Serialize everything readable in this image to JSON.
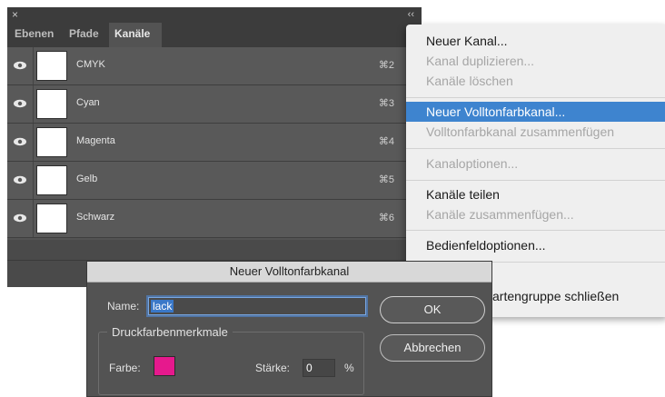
{
  "panel": {
    "close_glyph": "×",
    "collapse_glyph": "‹‹",
    "tabs": [
      {
        "label": "Ebenen"
      },
      {
        "label": "Pfade"
      },
      {
        "label": "Kanäle"
      }
    ],
    "channels": [
      {
        "name": "CMYK",
        "shortcut": "⌘2"
      },
      {
        "name": "Cyan",
        "shortcut": "⌘3"
      },
      {
        "name": "Magenta",
        "shortcut": "⌘4"
      },
      {
        "name": "Gelb",
        "shortcut": "⌘5"
      },
      {
        "name": "Schwarz",
        "shortcut": "⌘6"
      }
    ]
  },
  "menu": {
    "items": [
      {
        "label": "Neuer Kanal...",
        "enabled": true
      },
      {
        "label": "Kanal duplizieren...",
        "enabled": false
      },
      {
        "label": "Kanäle löschen",
        "enabled": false
      },
      {
        "label": "Neuer Volltonfarbkanal...",
        "enabled": true,
        "selected": true
      },
      {
        "label": "Volltonfarbkanal zusammenfügen",
        "enabled": false
      },
      {
        "label": "Kanaloptionen...",
        "enabled": false
      },
      {
        "label": "Kanäle teilen",
        "enabled": true
      },
      {
        "label": "Kanäle zusammenfügen...",
        "enabled": false
      },
      {
        "label": "Bedienfeldoptionen...",
        "enabled": true
      },
      {
        "label": "artengruppe schließen",
        "enabled": true
      }
    ]
  },
  "dialog": {
    "title": "Neuer Volltonfarbkanal",
    "name_label": "Name:",
    "name_value": "lack",
    "ok_label": "OK",
    "cancel_label": "Abbrechen",
    "group_title": "Druckfarbenmerkmale",
    "color_label": "Farbe:",
    "color_value": "#e6198d",
    "solidity_label": "Stärke:",
    "solidity_value": "0",
    "solidity_unit": "%"
  }
}
